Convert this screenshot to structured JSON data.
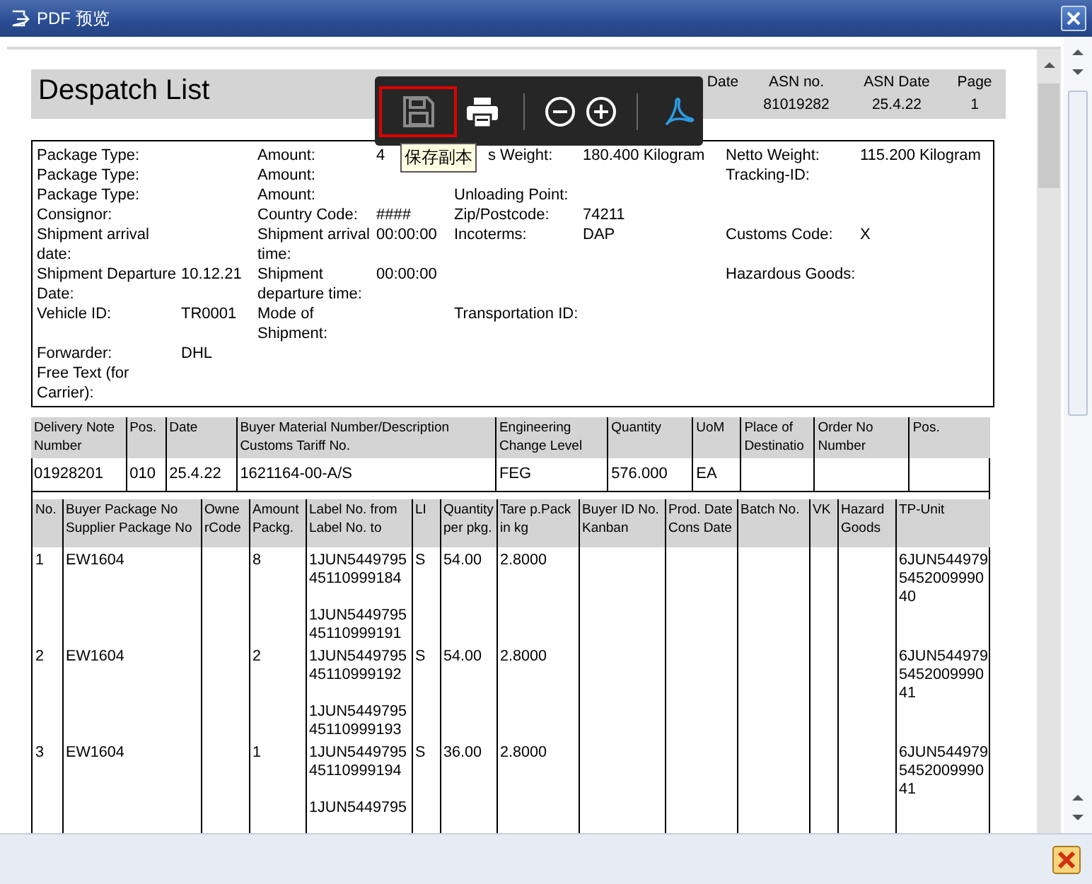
{
  "window": {
    "title": "PDF 预览"
  },
  "toolbar": {
    "tooltip": "保存副本"
  },
  "document": {
    "title": "Despatch List",
    "header": [
      {
        "label": "Date"
      },
      {
        "label": "ASN no.",
        "value": "81019282"
      },
      {
        "label": "ASN Date",
        "value": "25.4.22"
      },
      {
        "label": "Page",
        "value": "1"
      }
    ],
    "info_rows": [
      [
        "Package Type:",
        null,
        "Amount:",
        "4",
        {
          "text": "s Weight:",
          "partly_hidden": true
        },
        "180.400 Kilogram",
        "Netto Weight:",
        "115.200 Kilogram"
      ],
      [
        "Package Type:",
        null,
        "Amount:",
        null,
        null,
        null,
        "Tracking-ID:",
        null
      ],
      [
        "Package Type:",
        null,
        "Amount:",
        null,
        "Unloading Point:",
        null,
        null,
        null
      ],
      [
        "Consignor:",
        null,
        "Country Code:",
        "####",
        "Zip/Postcode:",
        "74211",
        null,
        null
      ],
      [
        "Shipment arrival date:",
        null,
        "Shipment arrival time:",
        "00:00:00",
        "Incoterms:",
        "DAP",
        "Customs Code:",
        "X"
      ],
      [
        "Shipment Departure Date:",
        "10.12.21",
        "Shipment departure time:",
        "00:00:00",
        null,
        null,
        "Hazardous Goods:",
        null
      ],
      [
        "Vehicle ID:",
        "TR0001",
        "Mode of Shipment:",
        null,
        "Transportation ID:",
        null,
        null,
        null
      ],
      [
        "Forwarder:",
        "DHL",
        null,
        null,
        null,
        null,
        null,
        null
      ],
      [
        "Free Text (for Carrier):",
        null,
        null,
        null,
        null,
        null,
        null,
        null
      ]
    ],
    "delivery_table": {
      "columns": [
        "Delivery Note\nNumber",
        "Pos.",
        "Date",
        "Buyer Material Number/Description\nCustoms Tariff No.",
        "Engineering\nChange Level",
        "Quantity",
        "UoM",
        "Place of\nDestinatio",
        "Order No\nNumber",
        "Pos."
      ],
      "rows": [
        [
          "01928201",
          "010",
          "25.4.22",
          "1621164-00-A/S",
          "FEG",
          "576.000",
          "EA",
          null,
          null,
          null
        ]
      ]
    },
    "package_table": {
      "columns": [
        "No.",
        "Buyer Package No\nSupplier Package No",
        "Owne\nrCode",
        "Amount\nPackg.",
        "Label No. from\nLabel No. to",
        "LI",
        "Quantity\nper pkg.",
        "Tare p.Pack\nin kg",
        "Buyer ID No.\nKanban",
        "Prod. Date\nCons Date",
        "Batch No.",
        "VK",
        "Hazard\nGoods",
        "TP-Unit"
      ],
      "rows": [
        {
          "no": "1",
          "buyer_package_no": "EW1604",
          "amount": "8",
          "label_from": "1JUN5449795\n45110999184",
          "label_to": "1JUN5449795\n45110999191",
          "li": "S",
          "quantity": "54.00",
          "tare": "2.8000",
          "tp_unit": "6JUN544979\n5452009990\n40"
        },
        {
          "no": "2",
          "buyer_package_no": "EW1604",
          "amount": "2",
          "label_from": "1JUN5449795\n45110999192",
          "label_to": "1JUN5449795\n45110999193",
          "li": "S",
          "quantity": "54.00",
          "tare": "2.8000",
          "tp_unit": "6JUN544979\n5452009990\n41"
        },
        {
          "no": "3",
          "buyer_package_no": "EW1604",
          "amount": "1",
          "label_from": "1JUN5449795\n45110999194",
          "label_to": "1JUN5449795",
          "li": "S",
          "quantity": "36.00",
          "tare": "2.8000",
          "tp_unit": "6JUN544979\n5452009990\n41"
        }
      ]
    }
  }
}
